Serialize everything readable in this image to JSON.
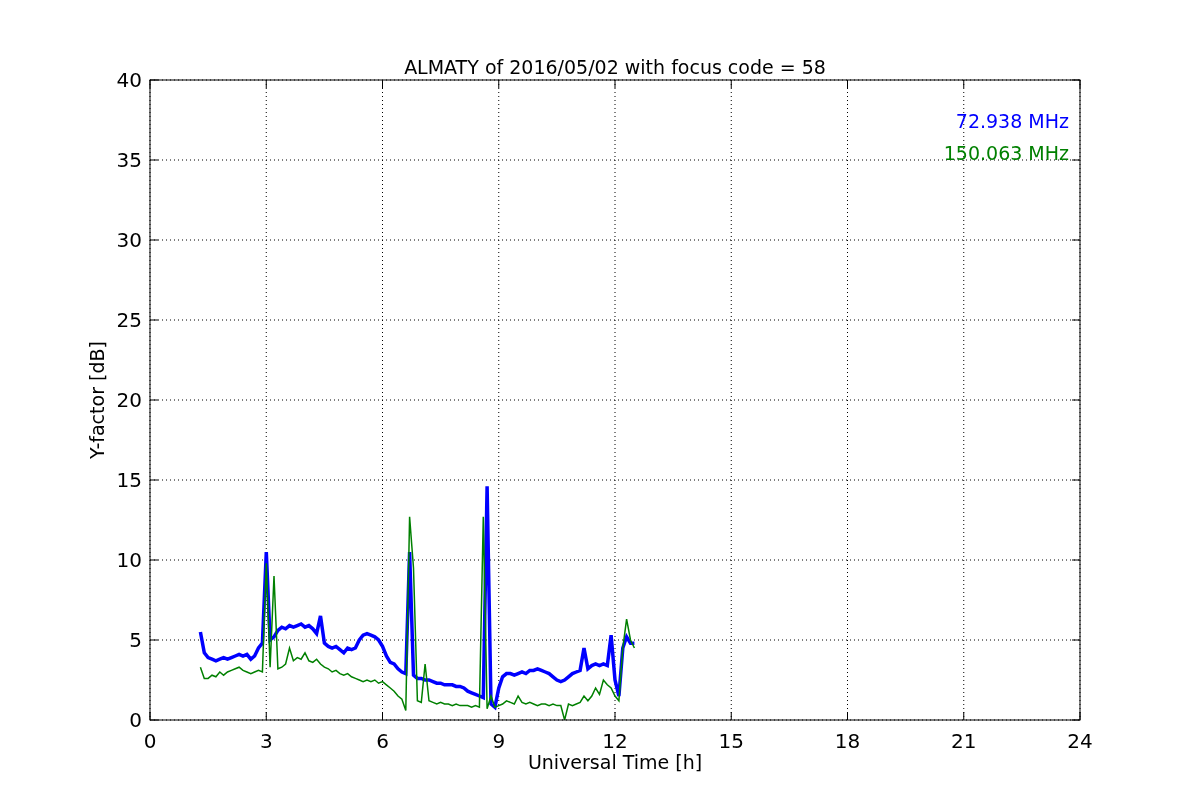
{
  "chart_data": {
    "type": "line",
    "title": "ALMATY of 2016/05/02 with focus code = 58",
    "xlabel": "Universal Time [h]",
    "ylabel": "Y-factor [dB]",
    "xlim": [
      0,
      24
    ],
    "ylim": [
      0,
      40
    ],
    "xticks": [
      0,
      3,
      6,
      9,
      12,
      15,
      18,
      21,
      24
    ],
    "yticks": [
      0,
      5,
      10,
      15,
      20,
      25,
      30,
      35,
      40
    ],
    "grid": true,
    "x": [
      1.3,
      1.4,
      1.5,
      1.6,
      1.7,
      1.8,
      1.9,
      2.0,
      2.1,
      2.2,
      2.3,
      2.4,
      2.5,
      2.6,
      2.7,
      2.8,
      2.9,
      3.0,
      3.1,
      3.2,
      3.3,
      3.4,
      3.5,
      3.6,
      3.7,
      3.8,
      3.9,
      4.0,
      4.1,
      4.2,
      4.3,
      4.4,
      4.5,
      4.6,
      4.7,
      4.8,
      4.9,
      5.0,
      5.1,
      5.2,
      5.3,
      5.4,
      5.5,
      5.6,
      5.7,
      5.8,
      5.9,
      6.0,
      6.1,
      6.2,
      6.3,
      6.4,
      6.5,
      6.6,
      6.7,
      6.8,
      6.9,
      7.0,
      7.1,
      7.2,
      7.3,
      7.4,
      7.5,
      7.6,
      7.7,
      7.8,
      7.9,
      8.0,
      8.1,
      8.2,
      8.3,
      8.4,
      8.5,
      8.6,
      8.7,
      8.8,
      8.9,
      9.0,
      9.1,
      9.2,
      9.3,
      9.4,
      9.5,
      9.6,
      9.7,
      9.8,
      9.9,
      10.0,
      10.1,
      10.2,
      10.3,
      10.4,
      10.5,
      10.6,
      10.7,
      10.8,
      10.9,
      11.0,
      11.1,
      11.2,
      11.3,
      11.4,
      11.5,
      11.6,
      11.7,
      11.8,
      11.9,
      12.0,
      12.1,
      12.2,
      12.3,
      12.4,
      12.5
    ],
    "series": [
      {
        "name": "72.938 MHz",
        "color": "#0000ff",
        "values": [
          5.5,
          4.2,
          3.9,
          3.8,
          3.7,
          3.8,
          3.9,
          3.8,
          3.9,
          4.0,
          4.1,
          4.0,
          4.1,
          3.8,
          4.0,
          4.5,
          4.8,
          10.5,
          5.0,
          5.2,
          5.6,
          5.8,
          5.7,
          5.9,
          5.8,
          5.9,
          6.0,
          5.8,
          5.9,
          5.7,
          5.4,
          6.5,
          4.8,
          4.6,
          4.5,
          4.6,
          4.4,
          4.2,
          4.5,
          4.4,
          4.5,
          5.0,
          5.3,
          5.4,
          5.3,
          5.2,
          5.0,
          4.6,
          4.0,
          3.6,
          3.5,
          3.2,
          3.0,
          2.9,
          10.5,
          2.8,
          2.6,
          2.6,
          2.5,
          2.5,
          2.4,
          2.3,
          2.3,
          2.2,
          2.2,
          2.2,
          2.1,
          2.1,
          2.0,
          1.8,
          1.7,
          1.6,
          1.5,
          1.4,
          14.6,
          1.0,
          0.8,
          2.0,
          2.7,
          2.9,
          2.9,
          2.8,
          2.9,
          3.0,
          2.9,
          3.1,
          3.1,
          3.2,
          3.1,
          3.0,
          2.9,
          2.7,
          2.5,
          2.4,
          2.5,
          2.7,
          2.9,
          3.0,
          3.1,
          4.5,
          3.2,
          3.4,
          3.5,
          3.4,
          3.5,
          3.4,
          5.3,
          2.5,
          1.5,
          4.5,
          5.2,
          4.8,
          4.8
        ]
      },
      {
        "name": "150.063 MHz",
        "color": "#008000",
        "values": [
          3.3,
          2.6,
          2.6,
          2.8,
          2.7,
          3.0,
          2.8,
          3.0,
          3.1,
          3.2,
          3.3,
          3.1,
          3.0,
          2.9,
          3.0,
          3.1,
          3.0,
          9.8,
          3.3,
          9.0,
          3.2,
          3.3,
          3.5,
          4.5,
          3.7,
          3.9,
          3.8,
          4.2,
          3.7,
          3.6,
          3.8,
          3.5,
          3.3,
          3.2,
          3.0,
          3.1,
          2.9,
          2.8,
          2.9,
          2.7,
          2.6,
          2.5,
          2.4,
          2.5,
          2.4,
          2.5,
          2.3,
          2.4,
          2.2,
          2.0,
          1.8,
          1.5,
          1.3,
          0.6,
          12.7,
          9.5,
          1.2,
          1.1,
          3.5,
          1.2,
          1.1,
          1.0,
          1.1,
          1.0,
          1.0,
          0.9,
          1.0,
          0.9,
          0.9,
          0.9,
          0.8,
          0.9,
          0.8,
          12.7,
          0.7,
          1.5,
          0.8,
          0.9,
          1.0,
          1.2,
          1.1,
          1.0,
          1.5,
          1.1,
          1.0,
          1.1,
          1.0,
          0.9,
          1.0,
          1.0,
          0.9,
          1.0,
          0.9,
          0.9,
          0,
          1.0,
          0.9,
          1.0,
          1.1,
          1.5,
          1.2,
          1.5,
          2.0,
          1.6,
          2.5,
          2.2,
          2.0,
          1.5,
          1.2,
          4.5,
          6.3,
          5.0,
          4.5
        ]
      }
    ]
  }
}
